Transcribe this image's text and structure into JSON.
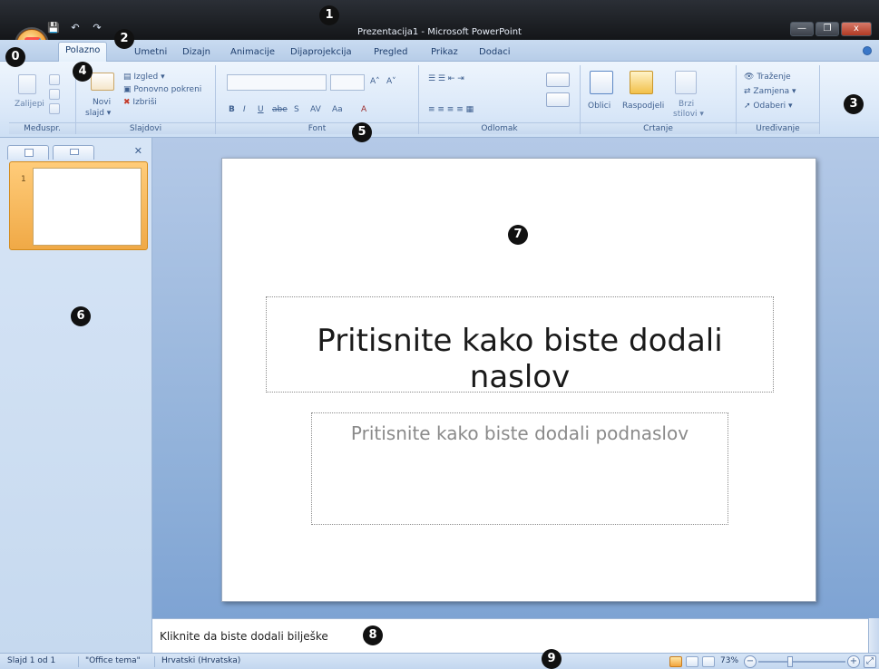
{
  "window": {
    "title": "Prezentacija1 - Microsoft PowerPoint"
  },
  "qat": {
    "items": [
      {
        "icon": "save-icon",
        "glyph": "💾"
      },
      {
        "icon": "undo-icon",
        "glyph": "↶"
      },
      {
        "icon": "redo-icon",
        "glyph": "↷"
      }
    ]
  },
  "tabs": [
    {
      "label": "Polazno",
      "active": true
    },
    {
      "label": "Umetni"
    },
    {
      "label": "Dizajn"
    },
    {
      "label": "Animacije"
    },
    {
      "label": "Dijaprojekcija"
    },
    {
      "label": "Pregled"
    },
    {
      "label": "Prikaz"
    },
    {
      "label": "Dodaci"
    }
  ],
  "ribbon": {
    "groups": {
      "meduspr": {
        "label": "Međuspr."
      },
      "slajdovi": {
        "label": "Slajdovi"
      },
      "font": {
        "label": "Font"
      },
      "odlomak": {
        "label": "Odlomak"
      },
      "crtanje": {
        "label": "Crtanje"
      },
      "uredivanje": {
        "label": "Uređivanje"
      }
    },
    "buttons": {
      "paste": "Zalijepi",
      "new_slide_line1": "Novi",
      "new_slide_line2": "slajd",
      "layout": "Izgled",
      "reset": "Ponovno pokreni",
      "delete": "Izbriši",
      "shapes": "Oblici",
      "arrange": "Raspodjeli",
      "quick_styles_line1": "Brzi",
      "quick_styles_line2": "stilovi",
      "find": "Traženje",
      "replace": "Zamjena",
      "select": "Odaberi"
    },
    "font_controls": {
      "bold": "B",
      "italic": "I",
      "underline": "U",
      "strike": "abe",
      "shadow": "S",
      "spacing": "AV",
      "case": "Aa",
      "color": "A",
      "grow": "A",
      "shrink": "A"
    }
  },
  "left_panel": {
    "slide_number": "1"
  },
  "slide": {
    "title_placeholder": "Pritisnite kako biste dodali naslov",
    "subtitle_placeholder": "Pritisnite kako biste dodali podnaslov"
  },
  "notes": {
    "placeholder": "Kliknite da biste dodali bilješke"
  },
  "status": {
    "slide_info": "Slajd 1 od 1",
    "theme": "\"Office tema\"",
    "language": "Hrvatski (Hrvatska)",
    "zoom": "73%"
  },
  "callouts": [
    "0",
    "1",
    "2",
    "3",
    "4",
    "5",
    "6",
    "7",
    "8",
    "9"
  ],
  "colors": {
    "accent": "#3a77c8",
    "office_button": "#f2a43c",
    "ribbon_text": "#3e5f8f"
  }
}
